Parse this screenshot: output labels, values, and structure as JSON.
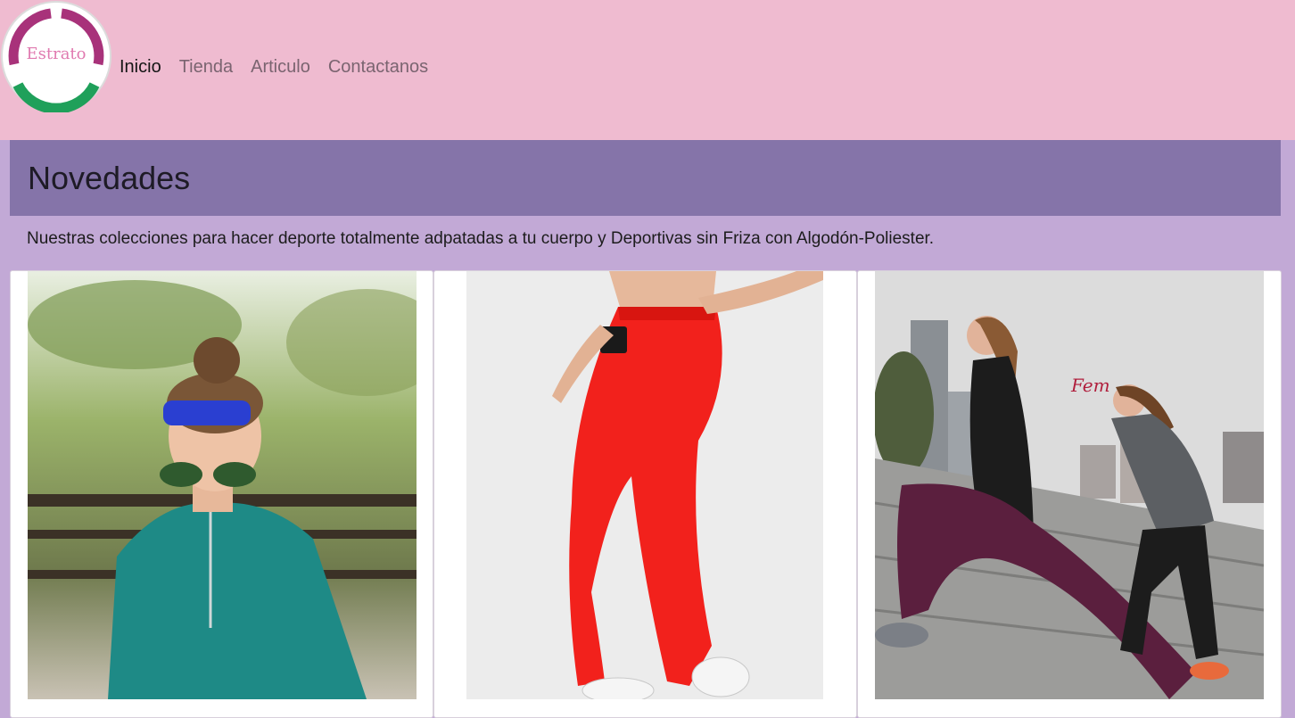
{
  "header": {
    "logo_text": "Estrato",
    "nav": [
      {
        "label": "Inicio",
        "active": true
      },
      {
        "label": "Tienda",
        "active": false
      },
      {
        "label": "Articulo",
        "active": false
      },
      {
        "label": "Contactanos",
        "active": false
      }
    ]
  },
  "section": {
    "title": "Novedades",
    "description": "Nuestras colecciones para hacer deporte totalmente adpatadas a tu cuerpo y Deportivas sin Friza con Algodón-Poliester."
  },
  "products": [
    {
      "image": "woman-running-headband-photo"
    },
    {
      "image": "red-leggings-photo"
    },
    {
      "image": "women-stretching-stairs-photo",
      "watermark_text": "Fem"
    }
  ],
  "colors": {
    "navbar": "#efbbd0",
    "section_header": "#8574a9",
    "page_background": "#c2a9d6",
    "logo_ring_top": "#a8327a",
    "logo_ring_bottom": "#1fa05a",
    "logo_text": "#e07ab0"
  }
}
